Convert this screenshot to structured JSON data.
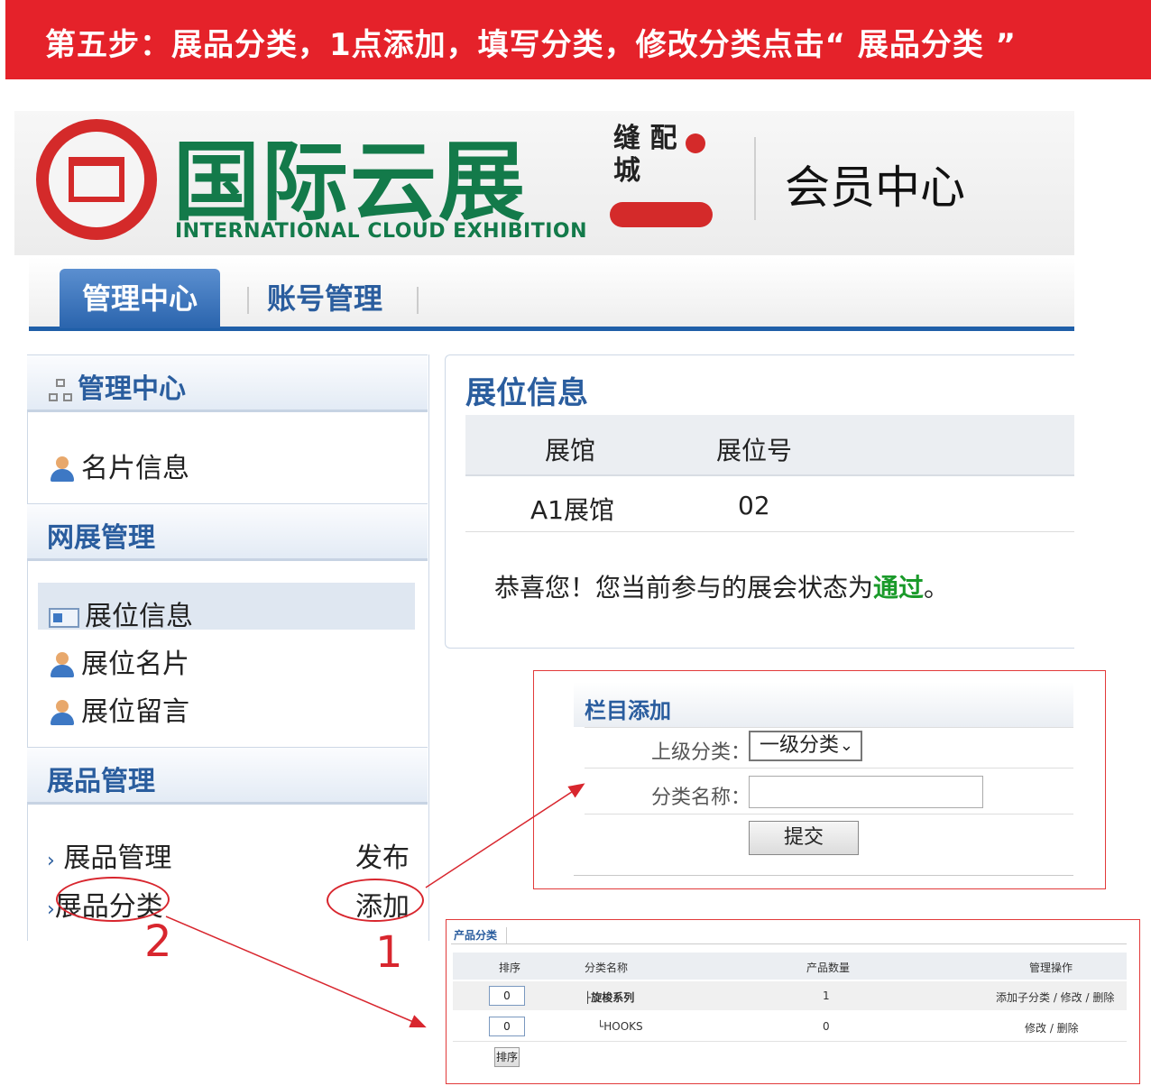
{
  "banner": {
    "text": "第五步：展品分类，1点添加，填写分类，修改分类点击“ 展品分类 ”"
  },
  "header": {
    "logo_title": "国际云展",
    "logo_subtitle": "INTERNATIONAL CLOUD EXHIBITION",
    "badge_text": "缝 配 城",
    "member_center": "会员中心"
  },
  "nav": {
    "tabs": [
      {
        "label": "管理中心"
      },
      {
        "label": "账号管理"
      }
    ]
  },
  "sidebar": {
    "section1": {
      "title": "管理中心",
      "items": [
        {
          "label": "名片信息"
        }
      ]
    },
    "section2": {
      "title": "网展管理",
      "items": [
        {
          "label": "展位信息"
        },
        {
          "label": "展位名片"
        },
        {
          "label": "展位留言"
        }
      ]
    },
    "section3": {
      "title": "展品管理",
      "items": [
        {
          "label": "展品管理",
          "action": "发布"
        },
        {
          "label": "展品分类",
          "action": "添加"
        }
      ]
    }
  },
  "main": {
    "title": "展位信息",
    "columns": [
      "展馆",
      "展位号"
    ],
    "row": [
      "A1展馆",
      "02"
    ],
    "congrats_prefix": "恭喜您！您当前参与的展会状态为",
    "congrats_status": "通过",
    "congrats_suffix": "。"
  },
  "add_form": {
    "title": "栏目添加",
    "parent_label": "上级分类：",
    "parent_value": "一级分类",
    "name_label": "分类名称：",
    "name_value": "",
    "submit_label": "提交"
  },
  "category_table": {
    "tab_label": "产品分类",
    "columns": [
      "排序",
      "分类名称",
      "产品数量",
      "管理操作"
    ],
    "rows": [
      {
        "sort": "0",
        "name": "├旋梭系列",
        "count": "1",
        "actions": "添加子分类 / 修改 / 删除"
      },
      {
        "sort": "0",
        "name": "└HOOKS",
        "count": "0",
        "actions": "修改 / 删除"
      }
    ],
    "sort_button": "排序"
  },
  "annotations": {
    "step1": "1",
    "step2": "2"
  },
  "colors": {
    "banner": "#e5222a",
    "brand_green": "#137a4a",
    "nav_blue": "#1f5fa8",
    "annotation_red": "#d8262e",
    "status_green": "#1a9a2a"
  }
}
